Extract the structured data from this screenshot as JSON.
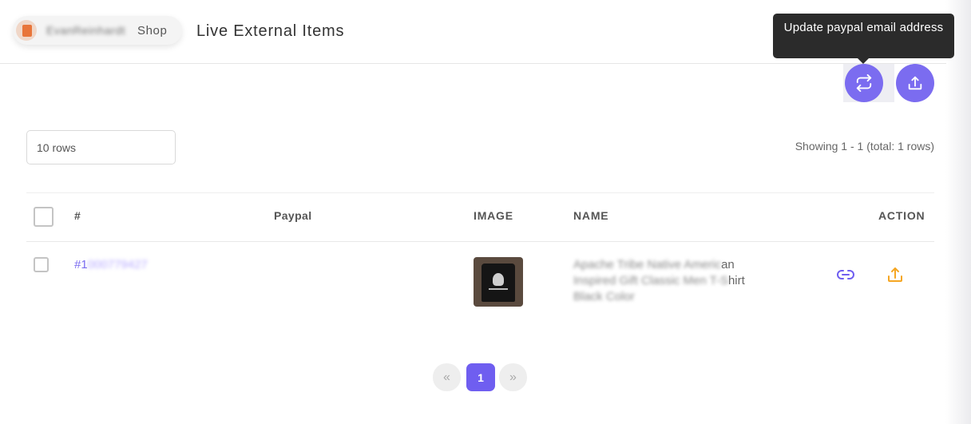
{
  "header": {
    "shop_owner": "EvanReinhardt",
    "shop_label": "Shop",
    "page_title": "Live External Items"
  },
  "tooltip": {
    "text": "Update paypal email address"
  },
  "actions": {
    "sync_icon": "sync-arrows-icon",
    "upload_icon": "upload-icon",
    "accent_color": "#7b6cf0"
  },
  "controls": {
    "rows_value": "10 rows",
    "showing_text": "Showing 1 - 1 (total: 1 rows)"
  },
  "table": {
    "columns": [
      "#",
      "Paypal",
      "IMAGE",
      "NAME",
      "ACTION"
    ],
    "rows": [
      {
        "id_prefix": "#1",
        "id_rest": "000779427",
        "paypal": "",
        "name_line1_blur": "Apache Tribe Native Americ",
        "name_line1_clear": "an",
        "name_line2_blur": "Inspired Gift Classic Men T-S",
        "name_line2_clear": "hirt",
        "name_line3_blur": "Black Color",
        "action_icons": [
          "link-icon",
          "upload-icon"
        ]
      }
    ]
  },
  "pagination": {
    "prev": "«",
    "current": "1",
    "next": "»"
  }
}
